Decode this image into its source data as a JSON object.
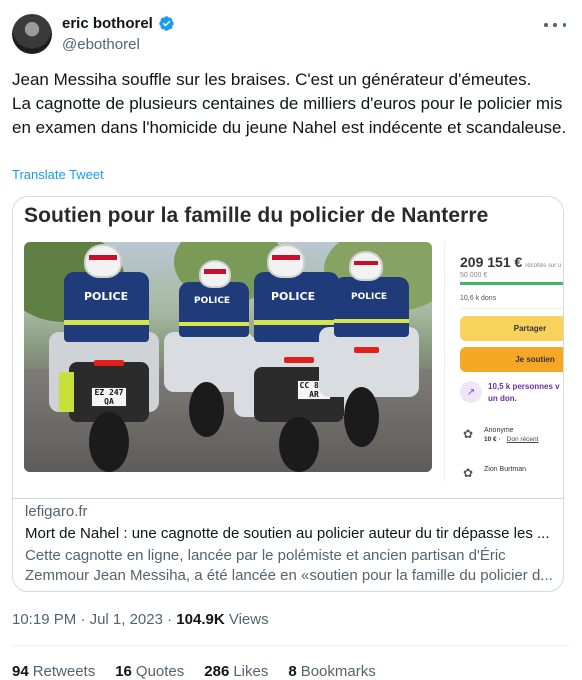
{
  "author": {
    "name": "eric bothorel",
    "handle": "@ebothorel",
    "verified": true,
    "verified_color": "#1d9bf0"
  },
  "tweet": {
    "text_lines": [
      "Jean Messiha souffle sur les braises. C'est un générateur d'émeutes.",
      "La cagnotte de plusieurs centaines de milliers d'euros pour le policier mis en examen dans l'homicide du jeune Nahel est indécente et scandaleuse."
    ],
    "translate_label": "Translate Tweet"
  },
  "card": {
    "media_title": "Soutien pour la famille du policier de Nanterre",
    "photo": {
      "police_label": "POLICE",
      "plates": [
        "EZ 247 QA",
        "CC 809 AR"
      ]
    },
    "fundraiser": {
      "amount": "209 151 €",
      "amount_suffix": "récoltés sur u",
      "goal": "50 000 €",
      "progress": 1.0,
      "dons": "10,6 k dons",
      "share_label": "Partager",
      "support_label": "Je soutien",
      "donors_highlight": "10,5 k personnes v un don.",
      "donations": [
        {
          "name": "Anonyme",
          "amount": "10 €",
          "separator": "·",
          "link": "Don récent"
        },
        {
          "name": "Zion Burtman",
          "amount": "",
          "separator": "",
          "link": ""
        }
      ],
      "accent_colors": {
        "share": "#f9d25b",
        "support": "#f5a726",
        "progress": "#43b36a",
        "highlight": "#6a2ea8"
      }
    },
    "domain": "lefigaro.fr",
    "title": "Mort de Nahel : une cagnotte de soutien au policier auteur du tir dépasse les ...",
    "description_lines": [
      "Cette cagnotte en ligne, lancée par le polémiste et ancien partisan d'Éric",
      "Zemmour Jean Messiha, a été lancée en «soutien pour la famille du policier d..."
    ]
  },
  "meta": {
    "time": "10:19 PM",
    "separator": "·",
    "date": "Jul 1, 2023",
    "views_count": "104.9K",
    "views_label": "Views"
  },
  "stats": {
    "retweets_count": "94",
    "retweets_label": "Retweets",
    "quotes_count": "16",
    "quotes_label": "Quotes",
    "likes_count": "286",
    "likes_label": "Likes",
    "bookmarks_count": "8",
    "bookmarks_label": "Bookmarks"
  }
}
